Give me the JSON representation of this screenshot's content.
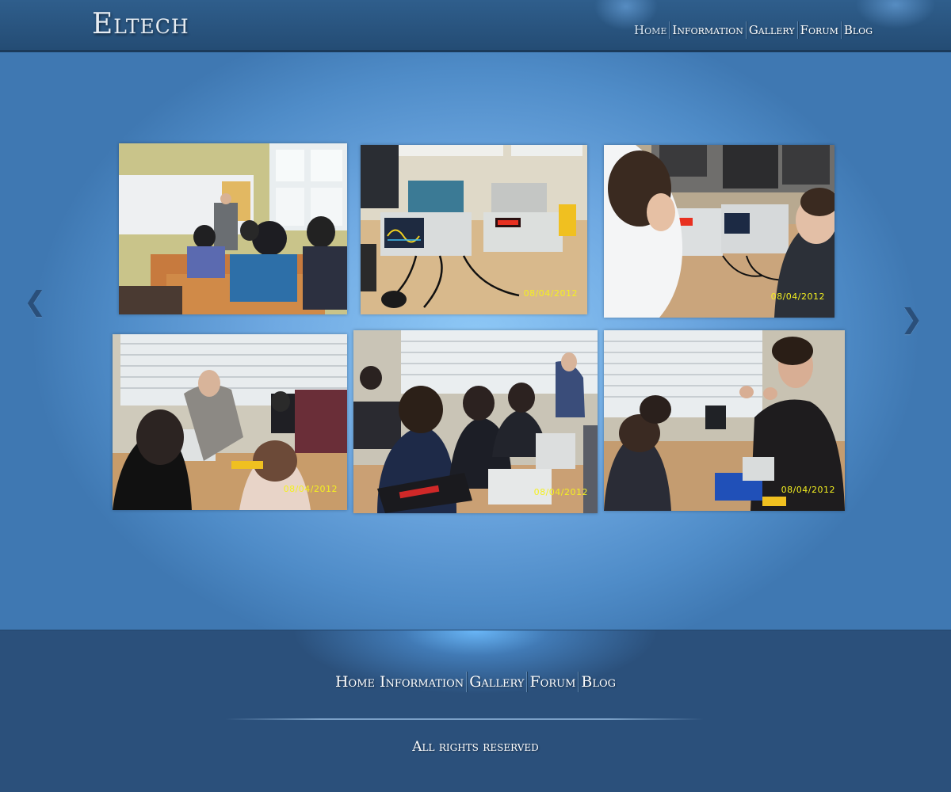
{
  "header": {
    "logo": "Eltech",
    "nav": [
      {
        "label": "Home",
        "active": true
      },
      {
        "label": "Information",
        "active": false
      },
      {
        "label": "Gallery",
        "active": false
      },
      {
        "label": "Forum",
        "active": false
      },
      {
        "label": "Blog",
        "active": false
      }
    ]
  },
  "gallery": {
    "prev_icon": "chevron-left-icon",
    "next_icon": "chevron-right-icon",
    "photos": [
      {
        "subject": "classroom-lecture",
        "date": ""
      },
      {
        "subject": "lab-oscilloscope",
        "date": "08/04/2012"
      },
      {
        "subject": "students-at-instruments",
        "date": "08/04/2012"
      },
      {
        "subject": "teacher-helping-students",
        "date": "08/04/2012"
      },
      {
        "subject": "students-with-power-supplies",
        "date": "08/04/2012"
      },
      {
        "subject": "teacher-explaining",
        "date": "08/04/2012"
      }
    ]
  },
  "footer": {
    "nav": [
      {
        "label": "Home"
      },
      {
        "label": "Information"
      },
      {
        "label": "Gallery"
      },
      {
        "label": "Forum"
      },
      {
        "label": "Blog"
      }
    ],
    "copyright": "All rights reserved"
  },
  "colors": {
    "header_bg": "#2a5581",
    "main_glow": "#8ec8f6",
    "footer_bg": "#2b507b",
    "date_stamp": "#f4f020"
  }
}
